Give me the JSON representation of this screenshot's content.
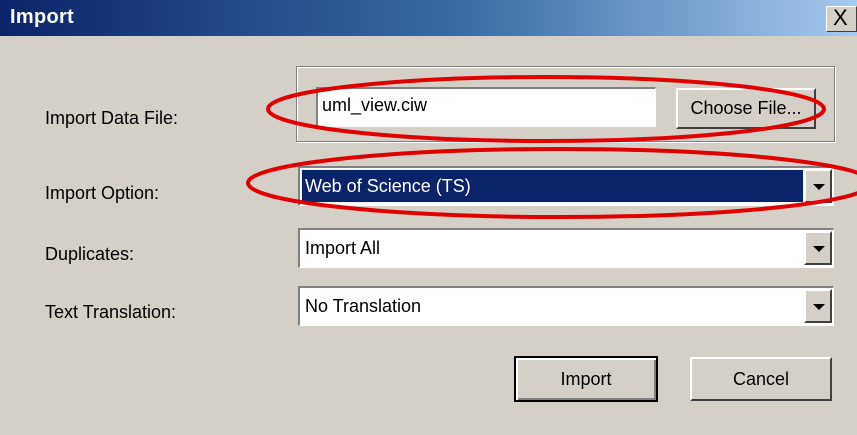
{
  "window": {
    "title": "Import",
    "close_glyph": "X"
  },
  "form": {
    "import_data_file_label": "Import Data File:",
    "import_data_file_value": "uml_view.ciw",
    "choose_file_label": "Choose File...",
    "import_option_label": "Import Option:",
    "import_option_value": "Web of Science (TS)",
    "duplicates_label": "Duplicates:",
    "duplicates_value": "Import All",
    "text_translation_label": "Text Translation:",
    "text_translation_value": "No Translation"
  },
  "buttons": {
    "import_label": "Import",
    "cancel_label": "Cancel"
  },
  "colors": {
    "annotation": "#e00000",
    "selection": "#0a246a",
    "dialog_bg": "#d4d0c8"
  },
  "icons": {
    "close": "close-icon",
    "dropdown": "chevron-down-icon"
  }
}
